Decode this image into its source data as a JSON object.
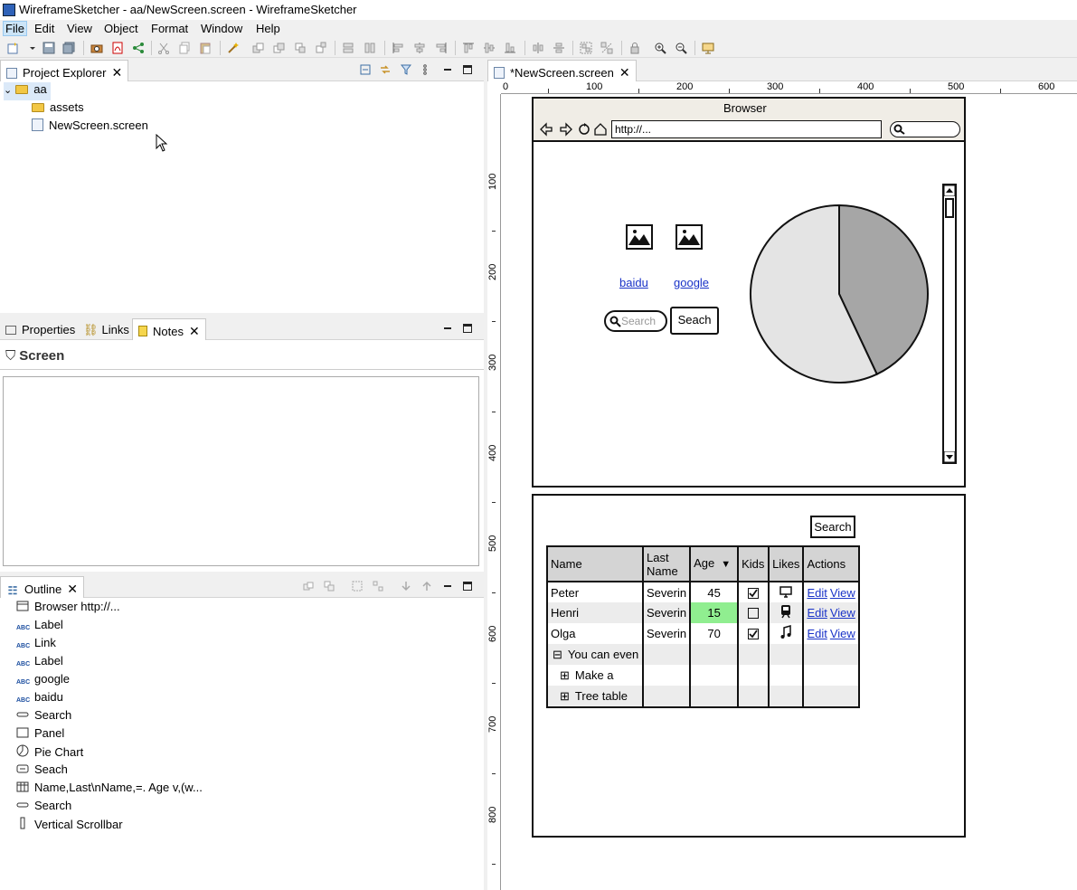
{
  "window": {
    "title": "WireframeSketcher - aa/NewScreen.screen - WireframeSketcher"
  },
  "menu": [
    "File",
    "Edit",
    "View",
    "Object",
    "Format",
    "Window",
    "Help"
  ],
  "project_explorer": {
    "tab": "Project Explorer",
    "root": "aa",
    "items": [
      "assets",
      "NewScreen.screen"
    ]
  },
  "properties_panel": {
    "tabs": [
      "Properties",
      "Links",
      "Notes"
    ],
    "heading": "Screen"
  },
  "outline": {
    "tab": "Outline",
    "items": [
      {
        "label": "Browser http://...",
        "icon": "browser-icon"
      },
      {
        "label": "Label",
        "icon": "label-icon"
      },
      {
        "label": "Link",
        "icon": "label-icon"
      },
      {
        "label": "Label",
        "icon": "label-icon"
      },
      {
        "label": "google",
        "icon": "label-icon"
      },
      {
        "label": "baidu",
        "icon": "label-icon"
      },
      {
        "label": "Search",
        "icon": "search-field-icon"
      },
      {
        "label": "Panel",
        "icon": "panel-icon"
      },
      {
        "label": "Pie Chart",
        "icon": "pie-chart-icon"
      },
      {
        "label": "Seach",
        "icon": "button-icon"
      },
      {
        "label": "Name,Last\\nName,=. Age v,(w...",
        "icon": "table-icon"
      },
      {
        "label": "Search",
        "icon": "search-field-icon"
      },
      {
        "label": "Vertical Scrollbar",
        "icon": "scrollbar-icon"
      }
    ]
  },
  "editor": {
    "tab": "*NewScreen.screen",
    "ruler_top": [
      "0",
      "100",
      "200",
      "300",
      "400",
      "500",
      "600"
    ],
    "ruler_left": [
      "100",
      "200",
      "300",
      "400",
      "500",
      "600",
      "700",
      "800"
    ]
  },
  "sketch": {
    "browser_title": "Browser",
    "url": "http://...",
    "link_baidu": "baidu",
    "link_google": "google",
    "search_placeholder": "Search",
    "seach_button": "Seach",
    "pie_slices": [
      {
        "share": 0.43,
        "color": "#a6a6a6"
      },
      {
        "share": 0.57,
        "color": "#e4e4e4"
      }
    ],
    "search_button_2": "Search",
    "table": {
      "headers": [
        "Name",
        "Last Name",
        "Age",
        "Kids",
        "Likes",
        "Actions"
      ],
      "rows": [
        {
          "name": "Peter",
          "last": "Severin",
          "age": "45",
          "kids": true,
          "likes": "monitor-icon",
          "edit": "Edit",
          "view": "View",
          "highlight": false
        },
        {
          "name": "Henri",
          "last": "Severin",
          "age": "15",
          "kids": false,
          "likes": "train-icon",
          "edit": "Edit",
          "view": "View",
          "highlight": true
        },
        {
          "name": "Olga",
          "last": "Severin",
          "age": "70",
          "kids": true,
          "likes": "music-icon",
          "edit": "Edit",
          "view": "View",
          "highlight": false
        }
      ],
      "tree_rows": [
        {
          "label": "You can even",
          "sign": "⊟"
        },
        {
          "label": "Make a",
          "sign": "⊞"
        },
        {
          "label": "Tree table",
          "sign": "⊞"
        }
      ],
      "highlight_color": "#90ee90"
    }
  }
}
